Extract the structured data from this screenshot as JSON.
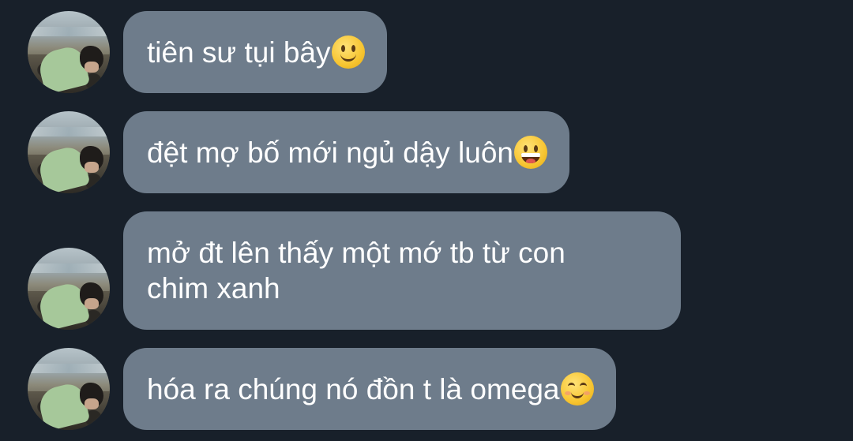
{
  "messages": [
    {
      "text": "tiên sư tụi bây",
      "emoji": "slightly-smiling-face-icon"
    },
    {
      "text": "đệt mợ bố mới ngủ dậy luôn",
      "emoji": "grinning-face-with-tongue-icon"
    },
    {
      "text": "mở đt lên thấy một mớ tb từ con\nchim xanh",
      "emoji": ""
    },
    {
      "text": "hóa ra chúng nó đồn t là omega",
      "emoji": "smiling-face-with-smiling-eyes-icon"
    }
  ],
  "colors": {
    "background": "#18202a",
    "bubble": "#6e7c8b",
    "text": "#ffffff"
  }
}
